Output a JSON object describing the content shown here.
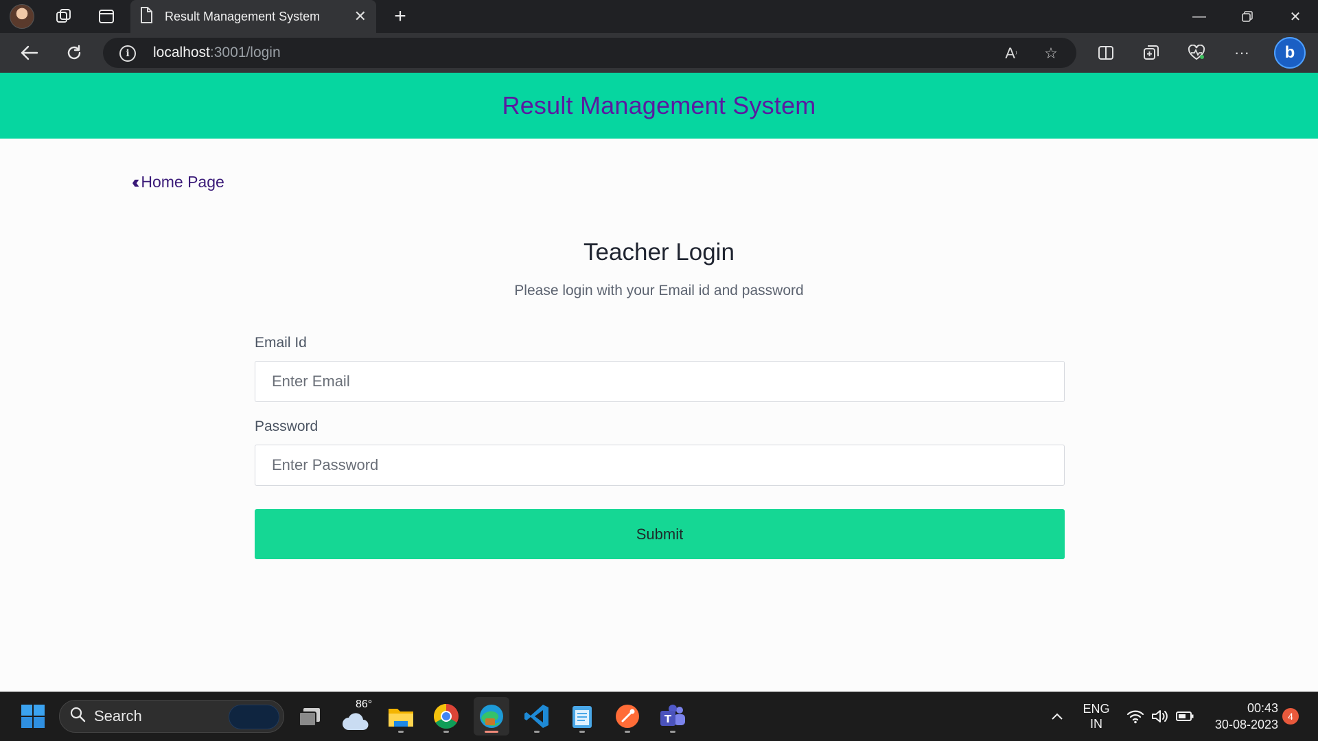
{
  "browser": {
    "tab_title": "Result Management System",
    "url_host": "localhost",
    "url_rest": ":3001/login"
  },
  "page": {
    "header_title": "Result Management System",
    "home_link": "Home Page",
    "login_title": "Teacher Login",
    "login_subtitle": "Please login with your Email id and password",
    "email_label": "Email Id",
    "email_placeholder": "Enter Email",
    "email_value": "",
    "password_label": "Password",
    "password_placeholder": "Enter Password",
    "password_value": "",
    "submit_label": "Submit"
  },
  "taskbar": {
    "search_label": "Search",
    "weather_temp": "86°",
    "lang_line1": "ENG",
    "lang_line2": "IN",
    "time": "00:43",
    "date": "30-08-2023",
    "notification_count": "4"
  },
  "colors": {
    "header_bg": "#06d6a0",
    "header_text": "#5b1aa0",
    "submit_bg": "#15d794"
  }
}
